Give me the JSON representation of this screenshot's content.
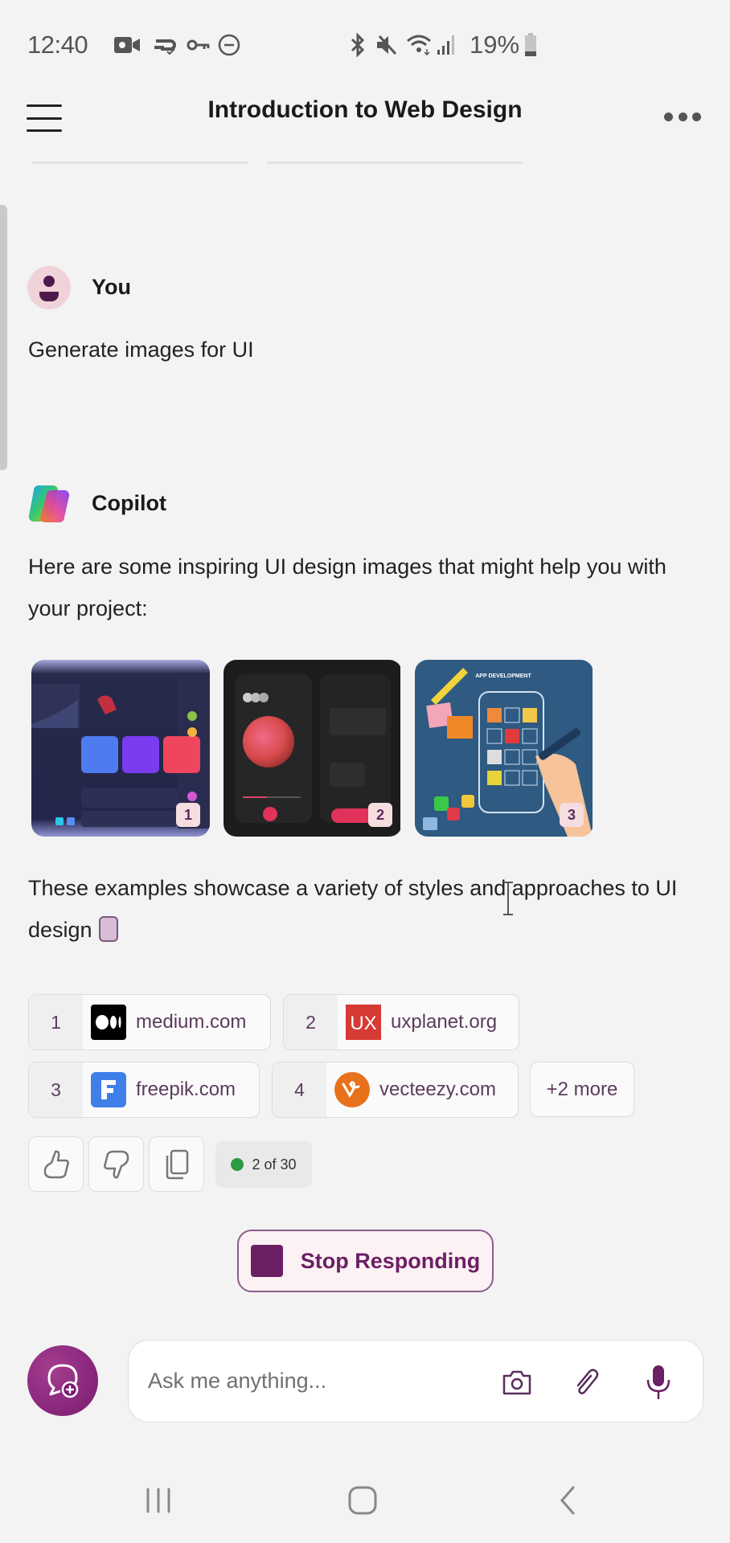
{
  "status_bar": {
    "time": "12:40",
    "left_icons": [
      "video-camera-icon",
      "sync-check-icon",
      "vpn-key-icon",
      "do-not-disturb-icon"
    ],
    "right_icons": [
      "bluetooth-icon",
      "mute-icon",
      "wifi-icon",
      "signal-icon"
    ],
    "battery": "19%"
  },
  "header": {
    "title": "Introduction to Web Design",
    "menu_icon": "hamburger-icon",
    "more_icon": "more-horizontal-icon"
  },
  "conversation": {
    "user_message": {
      "sender": "You",
      "text": "Generate images for UI"
    },
    "assistant_message": {
      "sender": "Copilot",
      "intro": "Here are some inspiring UI design images that might help you with your project:",
      "images": [
        {
          "index": "1",
          "description": "Dark dashboard UI design"
        },
        {
          "index": "2",
          "description": "Dark music player UI design"
        },
        {
          "index": "3",
          "description": "App development concept illustration"
        }
      ],
      "outro": "These examples showcase a variety of styles and approaches to UI design",
      "citations": [
        {
          "num": "1",
          "label": "medium.com",
          "logo": "medium-logo"
        },
        {
          "num": "2",
          "label": "uxplanet.org",
          "logo": "uxplanet-logo"
        },
        {
          "num": "3",
          "label": "freepik.com",
          "logo": "freepik-logo"
        },
        {
          "num": "4",
          "label": "vecteezy.com",
          "logo": "vecteezy-logo"
        }
      ],
      "more_citations": "+2 more",
      "turn_counter": "2 of 30"
    }
  },
  "stop_button": {
    "label": "Stop Responding"
  },
  "composer": {
    "placeholder": "Ask me anything...",
    "value": ""
  },
  "colors": {
    "accent": "#6b1f64",
    "background": "#f3f3f3",
    "status_ok": "#2d9b45"
  }
}
